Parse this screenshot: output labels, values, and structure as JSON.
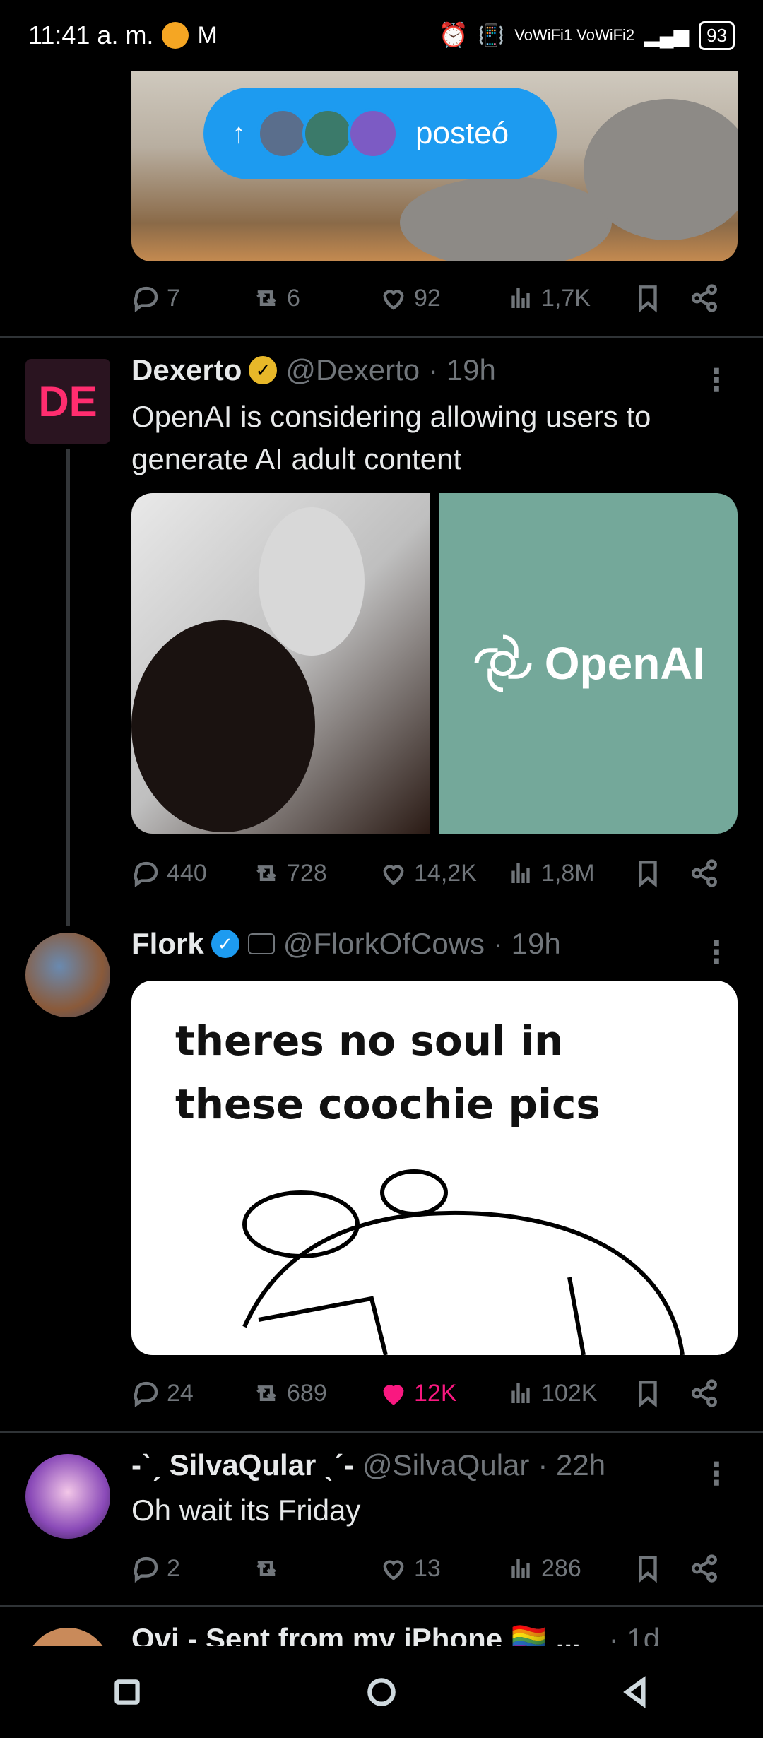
{
  "status_bar": {
    "time": "11:41 a. m.",
    "network_label": "VoWiFi1 VoWiFi2",
    "battery": "93"
  },
  "posted_pill": {
    "text": "posteó"
  },
  "top_tweet": {
    "actions": {
      "replies": "7",
      "retweets": "6",
      "likes": "92",
      "views": "1,7K"
    }
  },
  "tweet_dexerto": {
    "name": "Dexerto",
    "handle": "@Dexerto",
    "time": "· 19h",
    "text": "OpenAI is considering allowing users to generate AI adult content",
    "media_logo_text": "OpenAI",
    "actions": {
      "replies": "440",
      "retweets": "728",
      "likes": "14,2K",
      "views": "1,8M"
    }
  },
  "tweet_flork": {
    "name": "Flork",
    "handle": "@FlorkOfCows",
    "time": "· 19h",
    "meme_line1": "theres no soul in",
    "meme_line2": "these coochie pics",
    "actions": {
      "replies": "24",
      "retweets": "689",
      "likes": "12K",
      "views": "102K"
    }
  },
  "tweet_silva": {
    "name": "-ˋˏ SilvaQular ˎˊ-",
    "handle": "@SilvaQular",
    "time": "· 22h",
    "text": "Oh wait its Friday",
    "actions": {
      "replies": "2",
      "retweets": "",
      "likes": "13",
      "views": "286"
    }
  },
  "tweet_ovi": {
    "name": "Ovi - Sent from my iPhone 🏳️‍🌈 ...",
    "time": "· 1d"
  },
  "colors": {
    "accent": "#1d9bf0",
    "like": "#f91880",
    "muted": "#71767b",
    "gold_badge": "#e8b829"
  }
}
